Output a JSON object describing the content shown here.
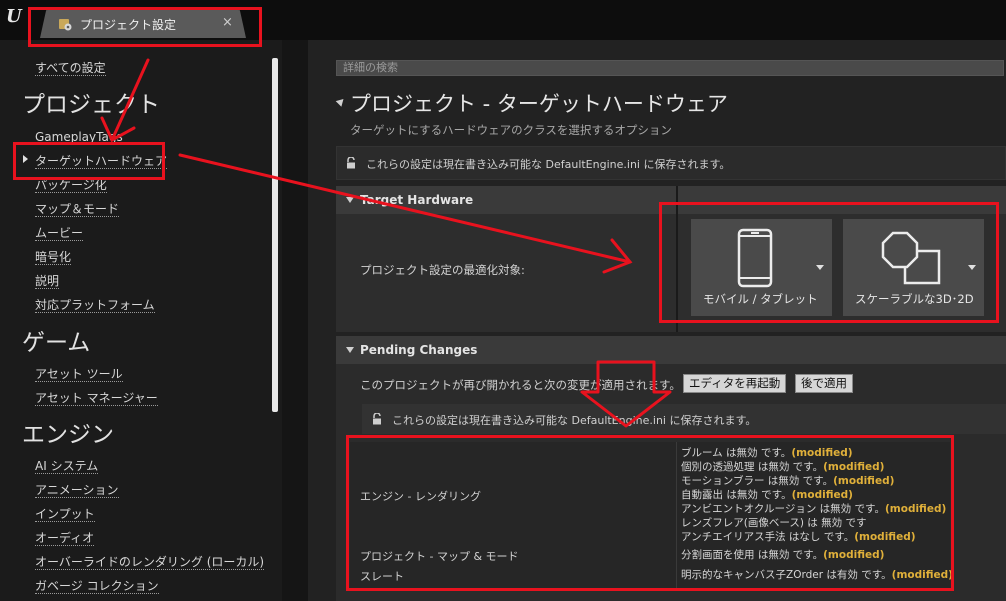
{
  "window": {
    "logo": "U",
    "tab_title": "プロジェクト設定",
    "tab_close": "×"
  },
  "sidebar": {
    "all_settings": "すべての設定",
    "sections": [
      {
        "title": "プロジェクト",
        "items": [
          "GameplayTags",
          "ターゲットハードウェア",
          "パッケージ化",
          "マップ＆モード",
          "ムービー",
          "暗号化",
          "説明",
          "対応プラットフォーム"
        ]
      },
      {
        "title": "ゲーム",
        "items": [
          "アセット ツール",
          "アセット マネージャー"
        ]
      },
      {
        "title": "エンジン",
        "items": [
          "AI システム",
          "アニメーション",
          "インプット",
          "オーディオ",
          "オーバーライドのレンダリング (ローカル)",
          "ガベージ コレクション"
        ]
      }
    ]
  },
  "search": {
    "placeholder": "詳細の検索"
  },
  "page": {
    "title": "プロジェクト - ターゲットハードウェア",
    "description": "ターゲットにするハードウェアのクラスを選択するオプション",
    "storage_notice": "これらの設定は現在書き込み可能な DefaultEngine.ini に保存されます。"
  },
  "target_hardware": {
    "header": "Target Hardware",
    "label": "プロジェクト設定の最適化対象:",
    "options": [
      {
        "label": "モバイル / タブレット",
        "icon": "mobile-phone-icon"
      },
      {
        "label": "スケーラブルな3D･2D",
        "icon": "scalable-shapes-icon"
      }
    ]
  },
  "pending_changes": {
    "header": "Pending Changes",
    "message": "このプロジェクトが再び開かれると次の変更が適用されます。",
    "restart_button": "エディタを再起動",
    "later_button": "後で適用",
    "notice": "これらの設定は現在書き込み可能な DefaultEngine.ini に保存されます。",
    "modified_tag": "(modified)",
    "groups": [
      {
        "label": "エンジン - レンダリング",
        "changes": [
          "ブルーム は無効 です。",
          "個別の透過処理 は無効 です。",
          "モーションブラー は無効 です。",
          "自動露出 は無効 です。",
          "アンビエントオクルージョン は無効 です。",
          "レンズフレア(画像ベース) は 無効 です",
          "アンチエイリアス手法 はなし です。"
        ],
        "modified": [
          true,
          true,
          true,
          true,
          true,
          false,
          true
        ]
      },
      {
        "label": "プロジェクト - マップ & モード",
        "changes": [
          "分割画面を使用 は無効 です。"
        ],
        "modified": [
          true
        ]
      },
      {
        "label": "スレート",
        "changes": [
          "明示的なキャンバス子ZOrder は有効 です。"
        ],
        "modified": [
          true
        ]
      }
    ]
  },
  "colors": {
    "annotation_red": "#e8121e",
    "modified_orange": "#e0b03a",
    "background": "#151515"
  }
}
